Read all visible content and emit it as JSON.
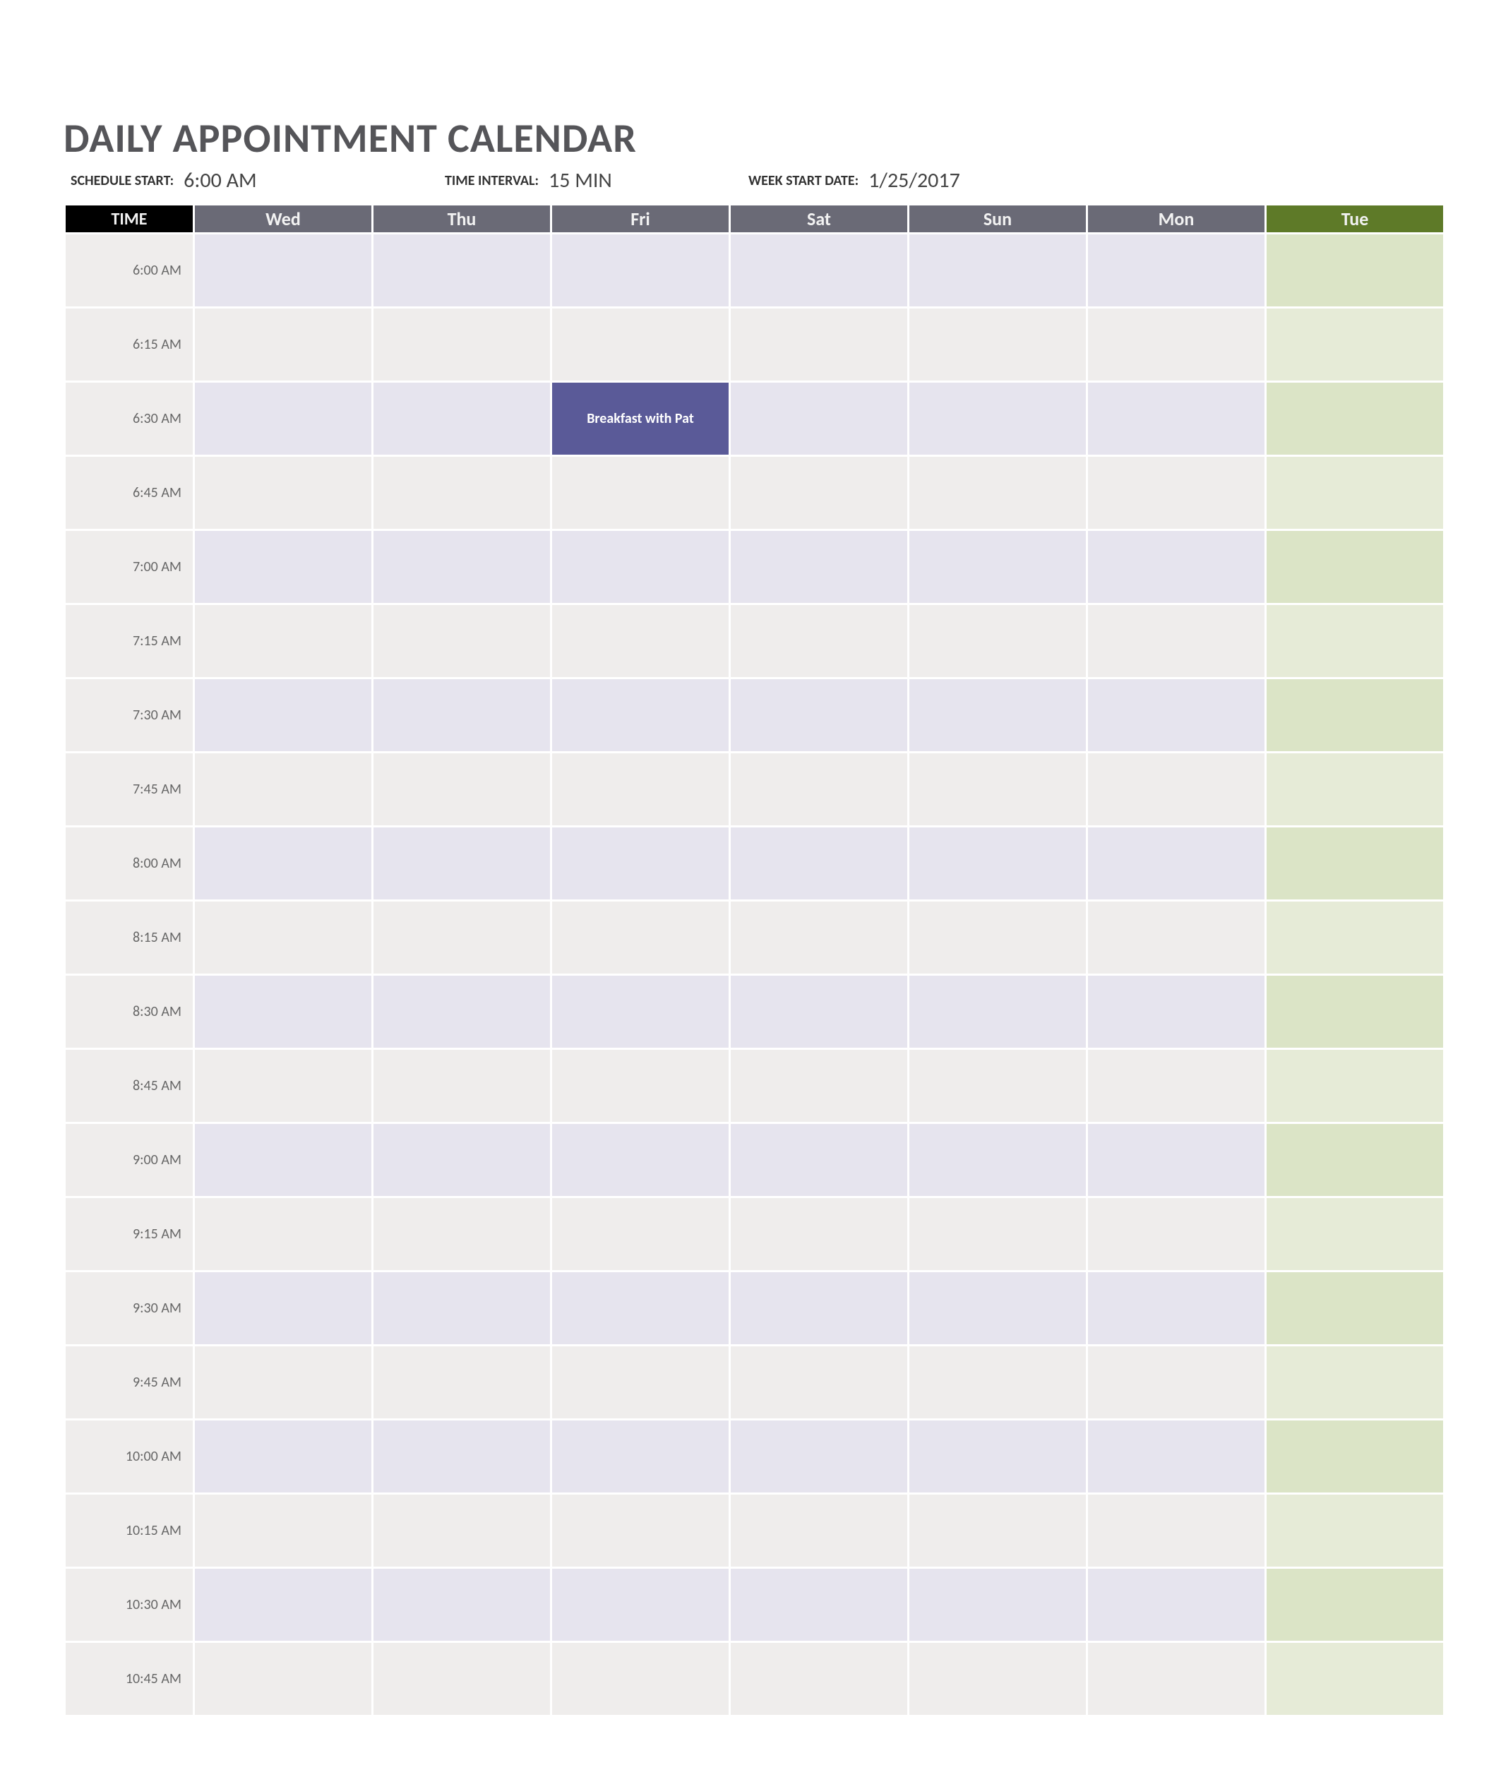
{
  "title": "DAILY APPOINTMENT CALENDAR",
  "params": {
    "schedule_start_label": "SCHEDULE START:",
    "schedule_start_value": "6:00 AM",
    "time_interval_label": "TIME INTERVAL:",
    "time_interval_value": "15 MIN",
    "week_start_label": "WEEK START DATE:",
    "week_start_value": "1/25/2017"
  },
  "header": {
    "time": "TIME",
    "days": [
      "Wed",
      "Thu",
      "Fri",
      "Sat",
      "Sun",
      "Mon",
      "Tue"
    ]
  },
  "times": [
    "6:00 AM",
    "6:15 AM",
    "6:30 AM",
    "6:45 AM",
    "7:00 AM",
    "7:15 AM",
    "7:30 AM",
    "7:45 AM",
    "8:00 AM",
    "8:15 AM",
    "8:30 AM",
    "8:45 AM",
    "9:00 AM",
    "9:15 AM",
    "9:30 AM",
    "9:45 AM",
    "10:00 AM",
    "10:15 AM",
    "10:30 AM",
    "10:45 AM"
  ],
  "appointments": [
    {
      "row": 2,
      "day": 2,
      "text": "Breakfast with Pat"
    }
  ]
}
